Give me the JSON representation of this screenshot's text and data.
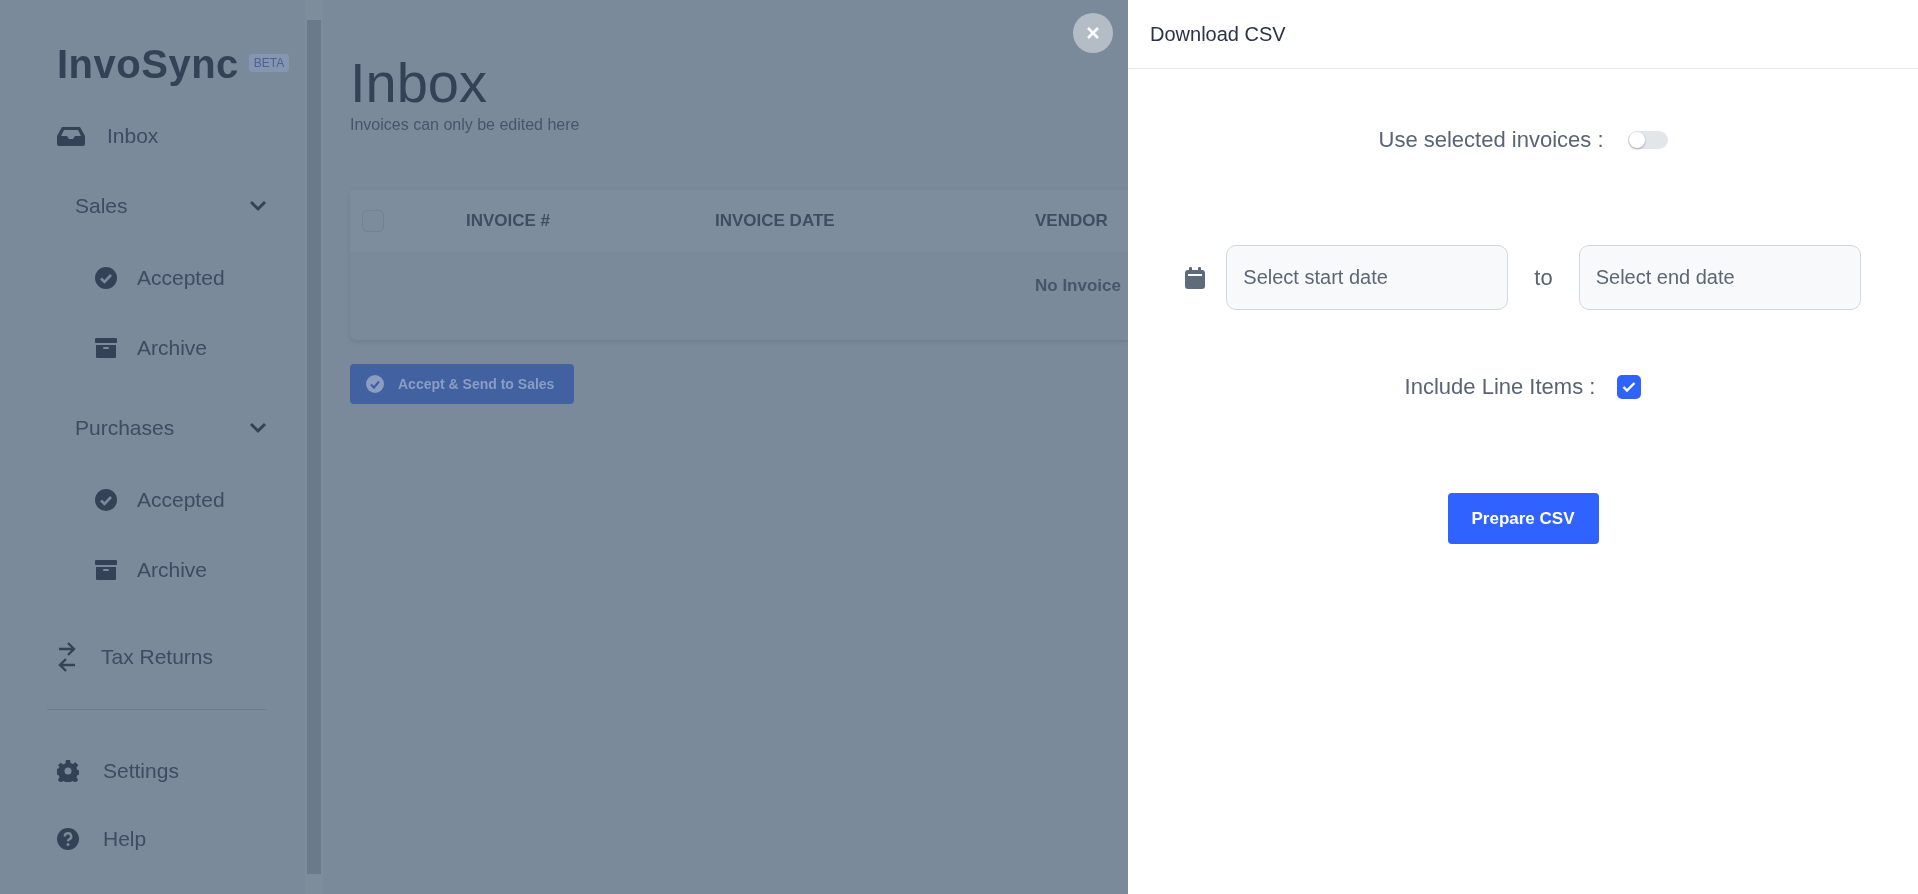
{
  "sidebar": {
    "logo": "InvoSync",
    "badge": "BETA",
    "items": [
      {
        "kind": "inbox",
        "label": "Inbox"
      },
      {
        "kind": "group",
        "label": "Sales",
        "expanded": true,
        "children": [
          {
            "kind": "accepted",
            "label": "Accepted"
          },
          {
            "kind": "archive",
            "label": "Archive"
          }
        ]
      },
      {
        "kind": "group",
        "label": "Purchases",
        "expanded": true,
        "children": [
          {
            "kind": "accepted",
            "label": "Accepted"
          },
          {
            "kind": "archive",
            "label": "Archive"
          }
        ]
      },
      {
        "kind": "tax",
        "label": "Tax Returns"
      }
    ],
    "footer_items": [
      {
        "kind": "settings",
        "label": "Settings"
      },
      {
        "kind": "help",
        "label": "Help"
      }
    ]
  },
  "main": {
    "title": "Inbox",
    "subtitle": "Invoices can only be edited here",
    "table": {
      "select_all": {
        "checked": false
      },
      "columns": [
        "INVOICE #",
        "INVOICE DATE",
        "VENDOR"
      ],
      "empty_text": "No Invoice"
    },
    "action_button": "Accept & Send to Sales"
  },
  "drawer": {
    "title": "Download CSV",
    "use_selected": {
      "label": "Use selected invoices :",
      "on": false
    },
    "date_range": {
      "start_placeholder": "Select start date",
      "separator": "to",
      "end_placeholder": "Select end date"
    },
    "include_line_items": {
      "label": "Include Line Items :",
      "checked": true
    },
    "submit_button": "Prepare CSV"
  }
}
